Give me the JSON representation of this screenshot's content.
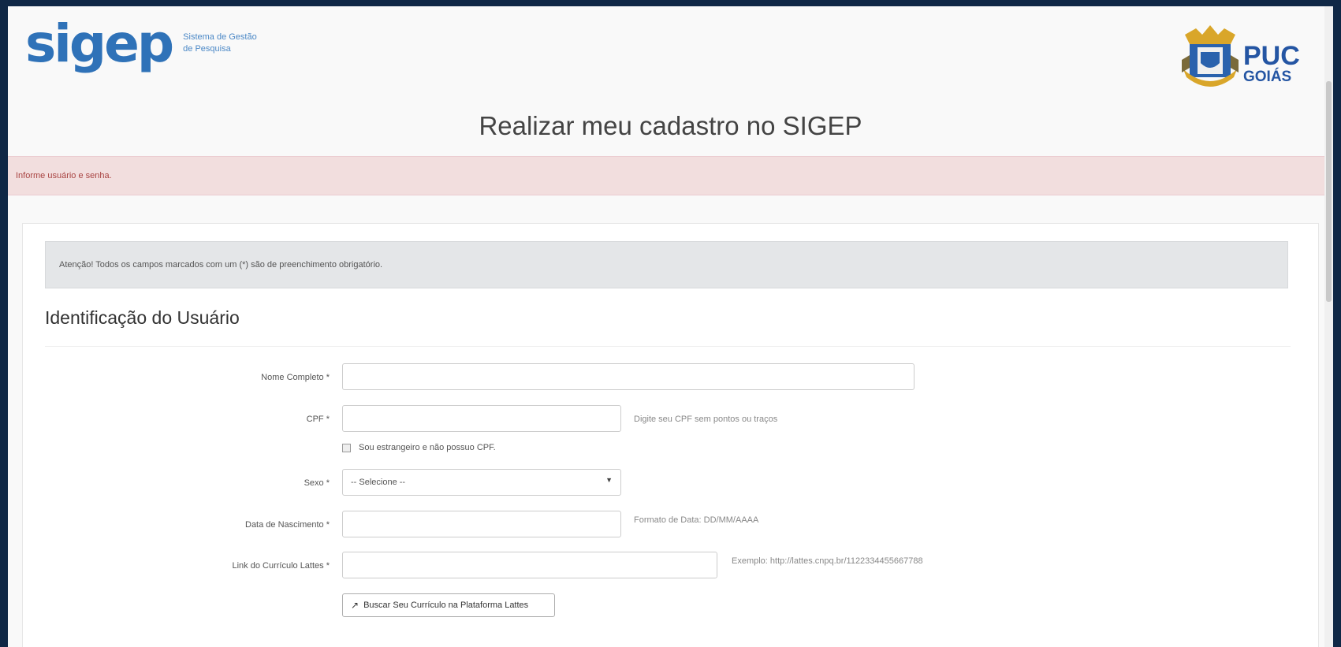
{
  "header": {
    "logo_word": "sigep",
    "logo_sub_line1": "Sistema de Gestão",
    "logo_sub_line2": "de Pesquisa",
    "puc_line1": "PUC",
    "puc_line2": "GOIÁS"
  },
  "page_title": "Realizar meu cadastro no SIGEP",
  "alert_text": "Informe usuário e senha.",
  "info_text": "Atenção! Todos os campos marcados com um (*) são de preenchimento obrigatório.",
  "section_title": "Identificação do Usuário",
  "form": {
    "nome": {
      "label": "Nome Completo *",
      "value": ""
    },
    "cpf": {
      "label": "CPF *",
      "value": "",
      "help": "Digite seu CPF sem pontos ou traços"
    },
    "estrangeiro": {
      "label": "Sou estrangeiro e não possuo CPF.",
      "checked": false
    },
    "sexo": {
      "label": "Sexo *",
      "selected": "-- Selecione --"
    },
    "nascimento": {
      "label": "Data de Nascimento *",
      "value": "",
      "help": "Formato de Data: DD/MM/AAAA"
    },
    "lattes": {
      "label": "Link do Currículo Lattes *",
      "value": "",
      "help": "Exemplo: http://lattes.cnpq.br/1122334455667788"
    },
    "lattes_button": "Buscar Seu Currículo na Plataforma Lattes"
  },
  "colors": {
    "brand_blue": "#2f72b8",
    "alert_bg": "#f2dede",
    "alert_text": "#a94442",
    "outer_bg": "#102846"
  }
}
